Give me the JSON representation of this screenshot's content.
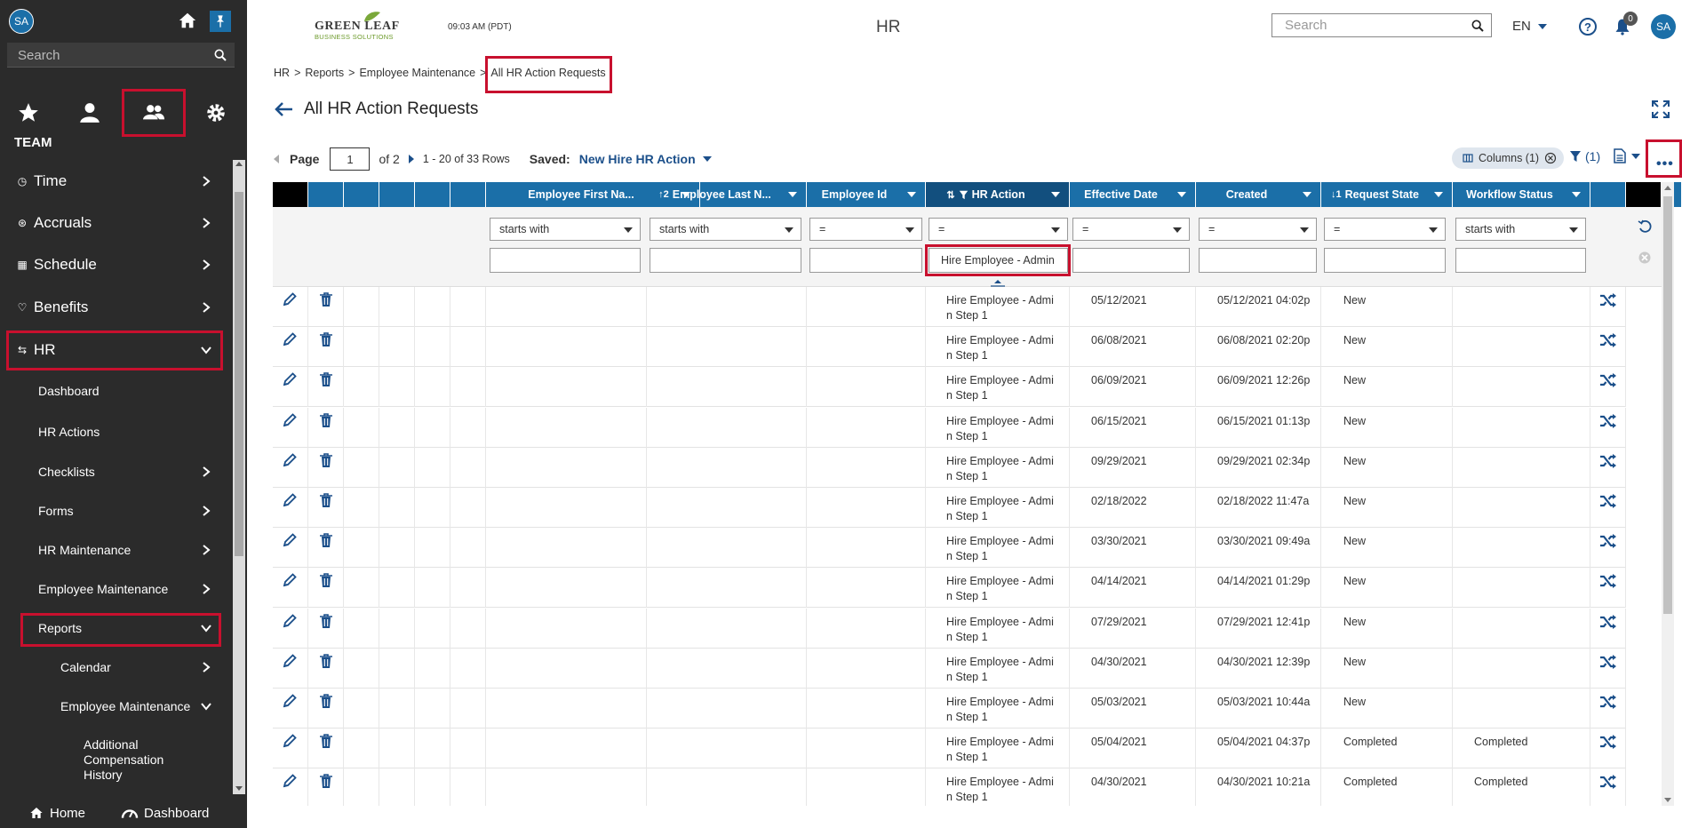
{
  "sidebar": {
    "avatar_initials": "SA",
    "search_placeholder": "Search",
    "team_label": "TEAM",
    "nav": [
      {
        "label": "Time"
      },
      {
        "label": "Accruals"
      },
      {
        "label": "Schedule"
      },
      {
        "label": "Benefits"
      },
      {
        "label": "HR"
      }
    ],
    "hr_sub": [
      {
        "label": "Dashboard"
      },
      {
        "label": "HR Actions"
      },
      {
        "label": "Checklists"
      },
      {
        "label": "Forms"
      },
      {
        "label": "HR Maintenance"
      },
      {
        "label": "Employee Maintenance"
      },
      {
        "label": "Reports"
      }
    ],
    "reports_sub": [
      {
        "label": "Calendar"
      },
      {
        "label": "Employee Maintenance"
      }
    ],
    "em_sub": {
      "label": "Additional Compensation History"
    },
    "bottom": {
      "home": "Home",
      "dashboard": "Dashboard"
    }
  },
  "header": {
    "logo_line1": "GREEN LEAF",
    "logo_line2": "BUSINESS SOLUTIONS",
    "time": "09:03 AM (PDT)",
    "title": "HR",
    "search_placeholder": "Search",
    "language": "EN",
    "notification_count": "0",
    "avatar_initials": "SA"
  },
  "breadcrumb": {
    "items": [
      "HR",
      ">",
      "Reports",
      ">",
      "Employee Maintenance",
      ">",
      "All HR Action Requests"
    ]
  },
  "page": {
    "title": "All HR Action Requests"
  },
  "toolbar": {
    "page_label": "Page",
    "page_value": "1",
    "of_pages": "of 2",
    "rows_info": "1 - 20 of 33 Rows",
    "saved_label": "Saved:",
    "saved_value": "New Hire HR Action",
    "columns_chip": "Columns (1)",
    "filter_count": "(1)"
  },
  "grid": {
    "columns": [
      {
        "label": "Employee First Na..."
      },
      {
        "label": "Employee Last N...",
        "sort": "↑2"
      },
      {
        "label": "Employee Id"
      },
      {
        "label": "HR Action",
        "sort": "⇅",
        "filtered": true
      },
      {
        "label": "Effective Date"
      },
      {
        "label": "Created"
      },
      {
        "label": "Request State",
        "sort": "↓1"
      },
      {
        "label": "Workflow Status"
      }
    ],
    "filters": {
      "operators": [
        "starts with",
        "starts with",
        "=",
        "=",
        "=",
        "=",
        "=",
        "starts with"
      ],
      "hr_action_value": "Hire Employee - Admin"
    },
    "rows": [
      {
        "hr_action_1": "Hire Employee - Admi",
        "hr_action_2": "n Step 1",
        "effective": "05/12/2021",
        "created": "05/12/2021 04:02p",
        "state": "New",
        "workflow": ""
      },
      {
        "hr_action_1": "Hire Employee - Admi",
        "hr_action_2": "n Step 1",
        "effective": "06/08/2021",
        "created": "06/08/2021 02:20p",
        "state": "New",
        "workflow": ""
      },
      {
        "hr_action_1": "Hire Employee - Admi",
        "hr_action_2": "n Step 1",
        "effective": "06/09/2021",
        "created": "06/09/2021 12:26p",
        "state": "New",
        "workflow": ""
      },
      {
        "hr_action_1": "Hire Employee - Admi",
        "hr_action_2": "n Step 1",
        "effective": "06/15/2021",
        "created": "06/15/2021 01:13p",
        "state": "New",
        "workflow": ""
      },
      {
        "hr_action_1": "Hire Employee - Admi",
        "hr_action_2": "n Step 1",
        "effective": "09/29/2021",
        "created": "09/29/2021 02:34p",
        "state": "New",
        "workflow": ""
      },
      {
        "hr_action_1": "Hire Employee - Admi",
        "hr_action_2": "n Step 1",
        "effective": "02/18/2022",
        "created": "02/18/2022 11:47a",
        "state": "New",
        "workflow": ""
      },
      {
        "hr_action_1": "Hire Employee - Admi",
        "hr_action_2": "n Step 1",
        "effective": "03/30/2021",
        "created": "03/30/2021 09:49a",
        "state": "New",
        "workflow": ""
      },
      {
        "hr_action_1": "Hire Employee - Admi",
        "hr_action_2": "n Step 1",
        "effective": "04/14/2021",
        "created": "04/14/2021 01:29p",
        "state": "New",
        "workflow": ""
      },
      {
        "hr_action_1": "Hire Employee - Admi",
        "hr_action_2": "n Step 1",
        "effective": "07/29/2021",
        "created": "07/29/2021 12:41p",
        "state": "New",
        "workflow": ""
      },
      {
        "hr_action_1": "Hire Employee - Admi",
        "hr_action_2": "n Step 1",
        "effective": "04/30/2021",
        "created": "04/30/2021 12:39p",
        "state": "New",
        "workflow": ""
      },
      {
        "hr_action_1": "Hire Employee - Admi",
        "hr_action_2": "n Step 1",
        "effective": "05/03/2021",
        "created": "05/03/2021 10:44a",
        "state": "New",
        "workflow": ""
      },
      {
        "hr_action_1": "Hire Employee - Admi",
        "hr_action_2": "n Step 1",
        "effective": "05/04/2021",
        "created": "05/04/2021 04:37p",
        "state": "Completed",
        "workflow": "Completed"
      },
      {
        "hr_action_1": "Hire Employee - Admi",
        "hr_action_2": "n Step 1",
        "effective": "04/30/2021",
        "created": "04/30/2021 10:21a",
        "state": "Completed",
        "workflow": "Completed"
      }
    ]
  },
  "colors": {
    "sidebar_bg": "#2b2b2b",
    "brand_blue": "#1b6fa8",
    "link_blue": "#1b4f8a",
    "highlight_red": "#c8102e"
  }
}
